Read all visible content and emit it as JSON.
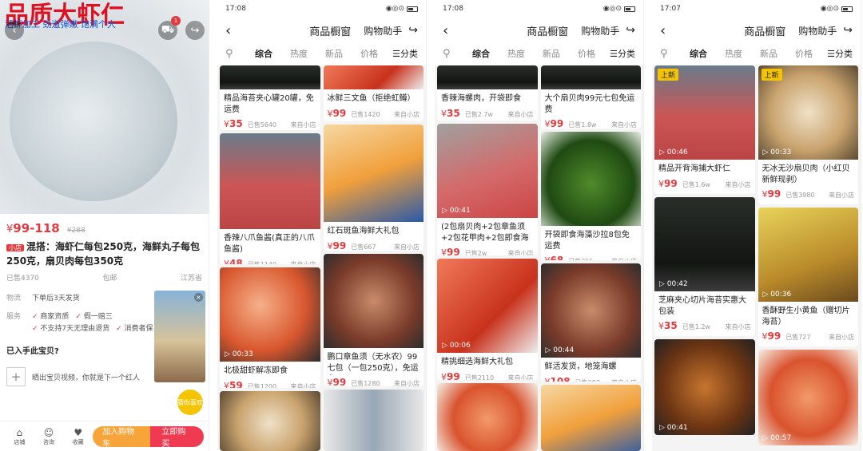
{
  "detail": {
    "hero_title": "品质大虾仁",
    "hero_sub": "活虾加工 劲道弹嫩 饱满个大",
    "cart_badge": "1",
    "price": "99-118",
    "old_price": "288",
    "mini_tag": "小店",
    "name": "混搭：海虾仁每包250克，海鲜丸子每包250克，扇贝肉每包350克",
    "sold": "已售4370",
    "postage": "包邮",
    "origin": "江苏省",
    "ship_key": "物流",
    "ship_val": "下单后3天发货",
    "svc_key": "服务",
    "services": [
      "商家资质",
      "假一赔三",
      "不支持7天无理由退货",
      "消费者保"
    ],
    "bought_q": "已入手此宝贝?",
    "share_tip": "晒出宝贝视频，你就是下一个红人",
    "badge_text": "猜你喜欢",
    "tabs": [
      {
        "icon": "⌂",
        "label": "店铺"
      },
      {
        "icon": "☺",
        "label": "咨询"
      },
      {
        "icon": "♥",
        "label": "收藏"
      }
    ],
    "add_cart": "加入购物车",
    "buy_now": "立即购买"
  },
  "status": {
    "p1": "17:08",
    "p2": "17:08",
    "p3": "17:08",
    "p4": "17:07"
  },
  "header": {
    "title": "商品橱窗",
    "assistant": "购物助手"
  },
  "filters": [
    "综合",
    "热度",
    "新品",
    "价格"
  ],
  "category": "分类",
  "yen": "¥",
  "shop": "来自小店",
  "p2": {
    "col1": [
      {
        "name": "精品海苔夹心罐20罐，免运费",
        "price": "35",
        "sold": "已售5640",
        "img": "nori",
        "h": 0
      },
      {
        "name": "香辣八爪鱼酱(真正的八爪鱼酱)",
        "price": "48",
        "sold": "已售1140",
        "img": "person",
        "h": 120
      },
      {
        "name": "北极甜虾解冻即食",
        "price": "59",
        "sold": "已售1200",
        "img": "shrimp",
        "h": 118,
        "vid": "00:33"
      },
      {
        "name": "",
        "price": "",
        "sold": "",
        "img": "scallop",
        "h": 80
      }
    ],
    "col2": [
      {
        "name": "冰鲜三文鱼（拒绝虹鳟）",
        "price": "99",
        "sold": "已售1420",
        "img": "fish",
        "h": 0
      },
      {
        "name": "红石斑鱼海鲜大礼包",
        "price": "99",
        "sold": "已售667",
        "img": "box",
        "h": 122
      },
      {
        "name": "鹏口章鱼须（无水农）99七包（一包250克），免运费",
        "price": "99",
        "sold": "已售1280",
        "img": "octo",
        "h": 118
      },
      {
        "name": "",
        "price": "",
        "sold": "",
        "img": "bottles",
        "h": 80
      }
    ]
  },
  "p3": {
    "col1": [
      {
        "name": "香辣海螺肉，开袋即食",
        "price": "35",
        "sold": "已售2.7w",
        "img": "nori",
        "h": 0
      },
      {
        "name": "(2包扇贝肉+2包章鱼须+2包花甲肉+2包即食海",
        "price": "99",
        "sold": "已售2w",
        "img": "knife",
        "h": 118,
        "vid": "00:41"
      },
      {
        "name": "精挑细选海鲜大礼包",
        "price": "99",
        "sold": "已售2110",
        "img": "fish",
        "h": 118,
        "vid": "00:06"
      },
      {
        "name": "",
        "price": "",
        "sold": "",
        "img": "crab",
        "h": 90
      }
    ],
    "col2": [
      {
        "name": "大个扇贝肉99元七包免运费",
        "price": "99",
        "sold": "已售1.8w",
        "img": "nori",
        "h": 0
      },
      {
        "name": "开袋即食海藻沙拉8包免运费",
        "price": "68",
        "sold": "已售355",
        "img": "seaweed",
        "h": 118
      },
      {
        "name": "鲜活发货，地笼海螺",
        "price": "108",
        "sold": "已售287",
        "img": "octo",
        "h": 118,
        "vid": "00:44"
      },
      {
        "name": "",
        "price": "",
        "sold": "",
        "img": "box",
        "h": 90
      }
    ]
  },
  "p4": {
    "col1": [
      {
        "name": "精品开背海捕大虾仁",
        "price": "99",
        "sold": "已售1.6w",
        "img": "person",
        "h": 118,
        "tag": "上新",
        "vid": "00:46"
      },
      {
        "name": "芝麻夹心切片海苔实惠大包装",
        "price": "35",
        "sold": "已售1.2w",
        "img": "nori",
        "h": 118,
        "vid": "00:42"
      },
      {
        "name": "",
        "price": "",
        "sold": "",
        "img": "chicken",
        "h": 120,
        "vid": "00:41"
      }
    ],
    "col2": [
      {
        "name": "无冰无沙扇贝肉（小红贝新鲜现剥）",
        "price": "99",
        "sold": "已售3980",
        "img": "scallop",
        "h": 118,
        "tag": "上新",
        "vid": "00:33"
      },
      {
        "name": "香酥野生小黄鱼（赠切片海苔）",
        "price": "99",
        "sold": "已售727",
        "img": "yellowfish",
        "h": 118,
        "vid": "00:36"
      },
      {
        "name": "",
        "price": "",
        "sold": "",
        "img": "crab",
        "h": 120,
        "vid": "00:57"
      }
    ]
  }
}
